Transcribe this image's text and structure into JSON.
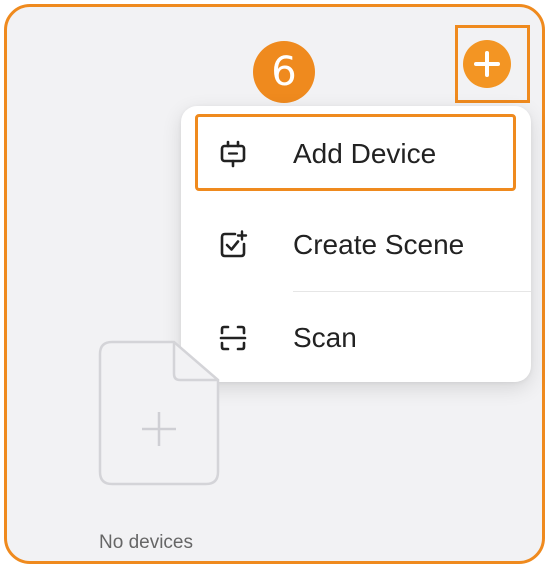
{
  "step_marker": {
    "number": "6"
  },
  "header": {
    "add_button_icon": "plus-circle-icon"
  },
  "menu": {
    "items": [
      {
        "label": "Add Device",
        "icon": "device-icon"
      },
      {
        "label": "Create Scene",
        "icon": "scene-check-icon"
      },
      {
        "label": "Scan",
        "icon": "scan-icon"
      }
    ]
  },
  "empty_state": {
    "icon": "add-document-icon",
    "text": "No devices"
  },
  "colors": {
    "accent": "#ef8a1e",
    "button": "#f39523",
    "background": "#f2f2f4",
    "menu_bg": "#ffffff",
    "text": "#222222",
    "muted_text": "#666666"
  }
}
